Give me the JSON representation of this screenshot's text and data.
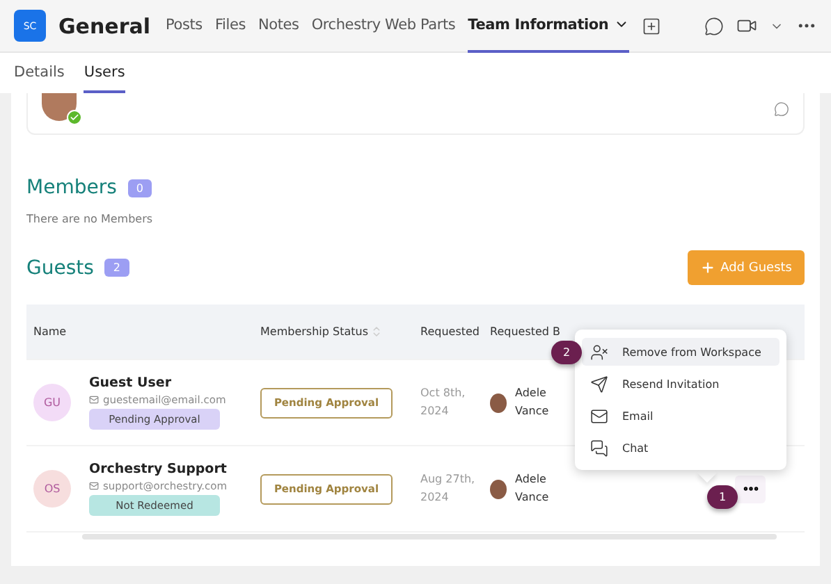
{
  "app": {
    "initials": "SC",
    "channel": "General",
    "tabs": [
      {
        "label": "Posts",
        "selected": false,
        "dropdown": false
      },
      {
        "label": "Files",
        "selected": false,
        "dropdown": false
      },
      {
        "label": "Notes",
        "selected": false,
        "dropdown": false
      },
      {
        "label": "Orchestry Web Parts",
        "selected": false,
        "dropdown": false
      },
      {
        "label": "Team Information",
        "selected": true,
        "dropdown": true
      }
    ]
  },
  "subtabs": [
    {
      "label": "Details",
      "selected": false
    },
    {
      "label": "Users",
      "selected": true
    }
  ],
  "members": {
    "title": "Members",
    "count": "0",
    "empty": "There are no Members"
  },
  "guests": {
    "title": "Guests",
    "count": "2",
    "add_button": "Add Guests",
    "columns": [
      "Name",
      "Membership Status",
      "Requested",
      "Requested B"
    ],
    "rows": [
      {
        "initials": "GU",
        "color": "#f3dcf7",
        "name": "Guest User",
        "email": "guestemail@email.com",
        "badge": "Pending Approval",
        "kind": "pending",
        "status": "Pending Approval",
        "requested": "Oct 8th, 2024",
        "requested_by": "Adele Vance"
      },
      {
        "initials": "OS",
        "color": "#f7dede",
        "name": "Orchestry Support",
        "email": "support@orchestry.com",
        "badge": "Not Redeemed",
        "kind": "not-redeemed",
        "status": "Pending Approval",
        "requested": "Aug 27th, 2024",
        "requested_by": "Adele Vance"
      }
    ]
  },
  "menu": {
    "items": [
      {
        "label": "Remove from Workspace",
        "kind": "remove-user",
        "selected": true
      },
      {
        "label": "Resend Invitation",
        "kind": "send",
        "selected": false
      },
      {
        "label": "Email",
        "kind": "mail",
        "selected": false
      },
      {
        "label": "Chat",
        "kind": "chat",
        "selected": false
      }
    ]
  },
  "callouts": [
    "1",
    "2"
  ]
}
